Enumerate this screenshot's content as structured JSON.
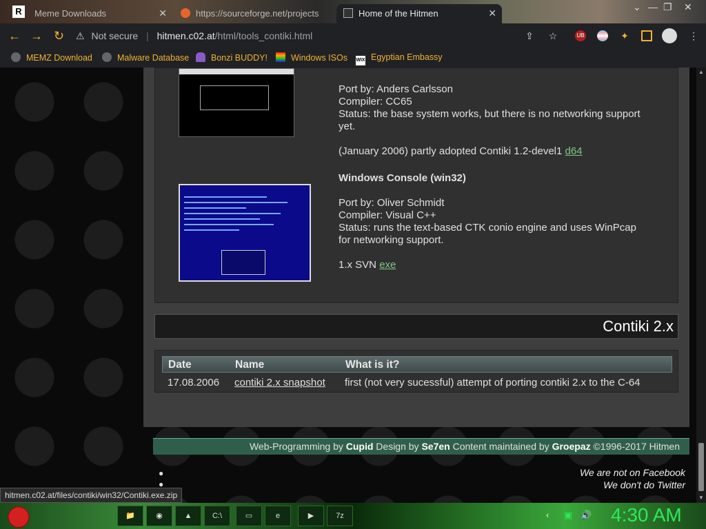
{
  "tabs": [
    {
      "label": "Meme Downloads"
    },
    {
      "label": "https://sourceforge.net/projects"
    },
    {
      "label": "Home of the Hitmen"
    }
  ],
  "window_controls": {
    "minimize": "—",
    "maximize": "❐",
    "close": "✕"
  },
  "address": {
    "security": "Not secure",
    "host": "hitmen.c02.at",
    "path": "/html/tools_contiki.html"
  },
  "bookmarks": [
    {
      "label": "MEMZ Download"
    },
    {
      "label": "Malware Database"
    },
    {
      "label": "Bonzi BUDDY!"
    },
    {
      "label": "Windows ISOs"
    },
    {
      "label": "Egyptian Embassy"
    }
  ],
  "c64": {
    "port": "Port by: Anders Carlsson",
    "compiler": "Compiler: CC65",
    "status1": "Status: the base system works, but there is no networking support",
    "status2": "yet.",
    "adopted": "(January 2006) partly adopted Contiki 1.2-devel1",
    "link": "d64"
  },
  "win32": {
    "title": "Windows Console (win32)",
    "port": "Port by: Oliver Schmidt",
    "compiler": "Compiler: Visual C++",
    "status1": "Status: runs the text-based CTK conio engine and uses WinPcap",
    "status2": "for networking support.",
    "svn": "1.x SVN",
    "link": "exe"
  },
  "section_title": "Contiki 2.x",
  "table": {
    "headers": [
      "Date",
      "Name",
      "What is it?"
    ],
    "row": {
      "date": "17.08.2006",
      "name": "contiki 2.x snapshot",
      "desc": "first (not very sucessful) attempt of porting contiki 2.x to the C-64"
    }
  },
  "footer": {
    "wp": "Web-Programming by",
    "cupid": "Cupid",
    "design": "Design by",
    "se7en": "Se7en",
    "content": "Content maintained by",
    "groepaz": "Groepaz",
    "copy": "©1996-2017 Hitmen"
  },
  "social": {
    "facebook": "We are not on Facebook",
    "twitter": "We don't do Twitter"
  },
  "status_url": "hitmen.c02.at/files/contiki/win32/Contiki.exe.zip",
  "taskbar": {
    "clock": "4:30 AM"
  }
}
